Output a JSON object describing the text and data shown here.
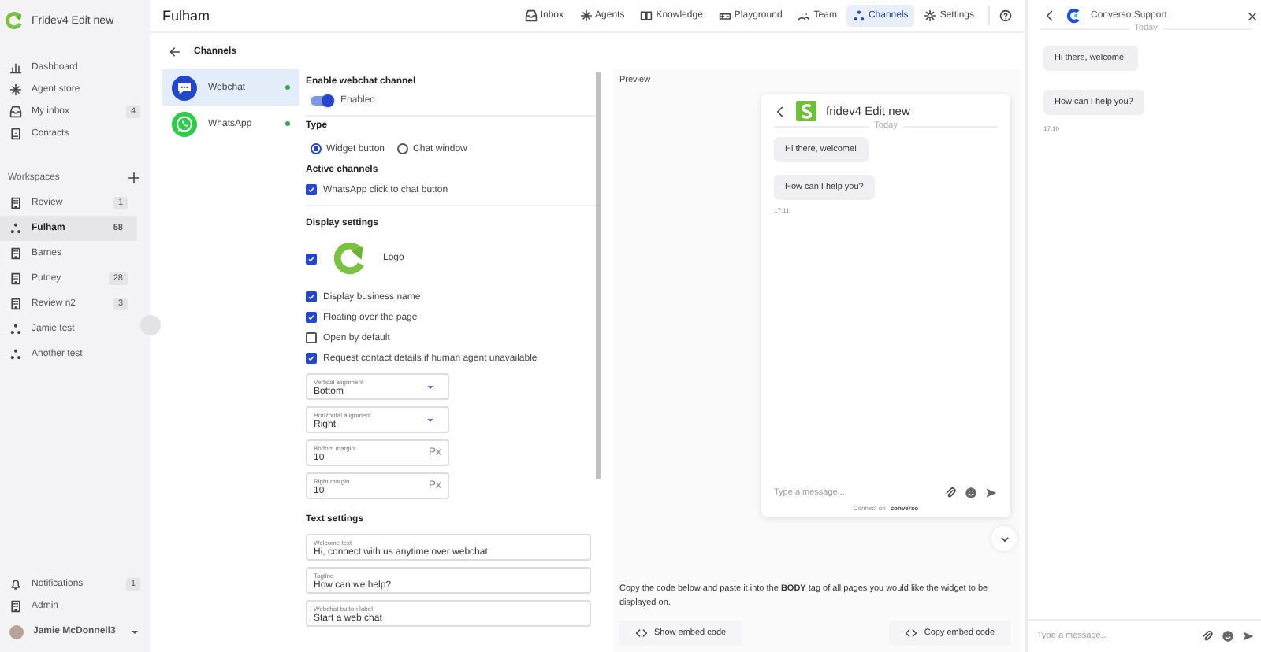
{
  "sidebar": {
    "app_name": "Fridev4 Edit new",
    "nav": [
      {
        "label": "Dashboard"
      },
      {
        "label": "Agent store"
      },
      {
        "label": "My inbox",
        "count": "4"
      },
      {
        "label": "Contacts"
      }
    ],
    "workspaces_heading": "Workspaces",
    "workspaces": [
      {
        "label": "Review",
        "count": "1",
        "kind": "building",
        "selected": false
      },
      {
        "label": "Fulham",
        "count": "58",
        "kind": "network",
        "selected": true
      },
      {
        "label": "Barnes",
        "kind": "building",
        "selected": false
      },
      {
        "label": "Putney",
        "count": "28",
        "kind": "building",
        "selected": false
      },
      {
        "label": "Review n2",
        "count": "3",
        "kind": "building",
        "selected": false
      },
      {
        "label": "Jamie test",
        "kind": "network",
        "selected": false
      },
      {
        "label": "Another test",
        "kind": "network",
        "selected": false
      }
    ],
    "bottom": [
      {
        "label": "Notifications",
        "count": "1"
      },
      {
        "label": "Admin"
      }
    ],
    "user": "Jamie McDonnell3"
  },
  "header": {
    "title": "Fulham",
    "tabs": [
      {
        "label": "Inbox",
        "selected": false
      },
      {
        "label": "Agents",
        "selected": false
      },
      {
        "label": "Knowledge",
        "selected": false
      },
      {
        "label": "Playground",
        "selected": false
      },
      {
        "label": "Team",
        "selected": false
      },
      {
        "label": "Channels",
        "selected": true
      },
      {
        "label": "Settings",
        "selected": false
      }
    ]
  },
  "page_title": "Channels",
  "channels": [
    {
      "label": "Webchat",
      "kind": "webchat",
      "selected": true,
      "active": true
    },
    {
      "label": "WhatsApp",
      "kind": "whatsapp",
      "selected": false,
      "active": true
    }
  ],
  "settings": {
    "enable": {
      "heading": "Enable webchat channel",
      "label": "Enabled",
      "on": true
    },
    "type": {
      "heading": "Type",
      "options": [
        {
          "label": "Widget button",
          "selected": true
        },
        {
          "label": "Chat window",
          "selected": false
        }
      ]
    },
    "active_channels": {
      "heading": "Active channels",
      "items": [
        {
          "label": "WhatsApp click to chat button",
          "checked": true
        }
      ]
    },
    "display": {
      "heading": "Display settings",
      "logo": {
        "label": "Logo",
        "checked": true
      },
      "items": [
        {
          "label": "Display business name",
          "checked": true
        },
        {
          "label": "Floating over the page",
          "checked": true
        },
        {
          "label": "Open by default",
          "checked": false
        },
        {
          "label": "Request contact details if human agent unavailable",
          "checked": true
        }
      ],
      "fields": [
        {
          "kind": "select",
          "label": "Vertical alignment",
          "value": "Bottom"
        },
        {
          "kind": "select",
          "label": "Horizontal alignment",
          "value": "Right"
        },
        {
          "kind": "number",
          "label": "Bottom margin",
          "value": "10",
          "unit": "Px"
        },
        {
          "kind": "number",
          "label": "Right margin",
          "value": "10",
          "unit": "Px"
        }
      ]
    },
    "text": {
      "heading": "Text settings",
      "fields": [
        {
          "label": "Welcome text",
          "value": "Hi, connect with us anytime over webchat"
        },
        {
          "label": "Tagline",
          "value": "How can we help?"
        },
        {
          "label": "Webchat button label",
          "value": "Start a web chat"
        }
      ]
    }
  },
  "preview": {
    "heading": "Preview",
    "widget": {
      "title": "fridev4 Edit new",
      "day": "Today",
      "messages": [
        "Hi there, welcome!",
        "How can I help you?"
      ],
      "time": "17:11",
      "placeholder": "Type a message...",
      "footer": "Connect on",
      "brand": "converso"
    },
    "note": "Copy the code below and paste it into the **BODY** tag of all pages you would like the widget to be displayed on.",
    "buttons": [
      "Show embed code",
      "Copy embed code"
    ]
  },
  "support_chat": {
    "title": "Converso Support",
    "day": "Today",
    "messages": [
      "Hi there, welcome!",
      "How can I help you?"
    ],
    "time": "17:10",
    "placeholder": "Type a message..."
  }
}
